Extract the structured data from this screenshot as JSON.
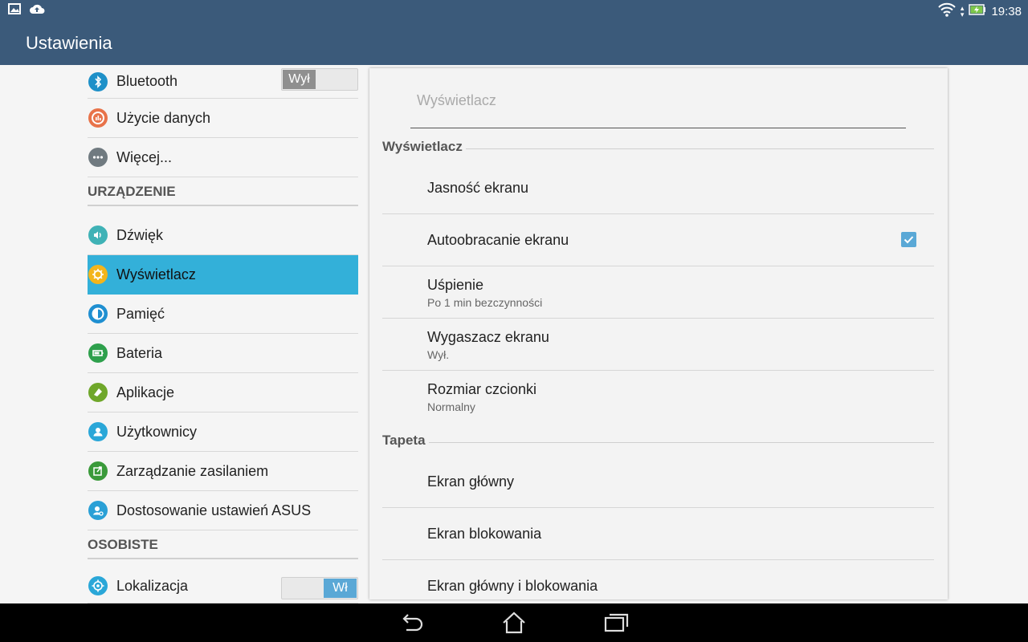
{
  "status_bar": {
    "time": "19:38",
    "icons": [
      "image-notification-icon",
      "cloud-upload-icon",
      "wifi-icon",
      "battery-charging-icon"
    ]
  },
  "action_bar": {
    "title": "Ustawienia"
  },
  "sidebar": {
    "items_top": [
      {
        "label": "Bluetooth",
        "icon": "bluetooth-icon",
        "toggle": "Wył",
        "color": "#1e90c8"
      },
      {
        "label": "Użycie danych",
        "icon": "data-usage-icon",
        "color": "#e8734a"
      },
      {
        "label": "Więcej...",
        "icon": "more-icon",
        "color": "#707a80"
      }
    ],
    "section_device": "URZĄDZENIE",
    "items_device": [
      {
        "label": "Dźwięk",
        "icon": "sound-icon",
        "color": "#3fb2b6"
      },
      {
        "label": "Wyświetlacz",
        "icon": "display-icon",
        "color": "#f3b51b",
        "selected": true
      },
      {
        "label": "Pamięć",
        "icon": "storage-icon",
        "color": "#1f8fd1"
      },
      {
        "label": "Bateria",
        "icon": "battery-icon",
        "color": "#2ea04c"
      },
      {
        "label": "Aplikacje",
        "icon": "apps-icon",
        "color": "#6fa72a"
      },
      {
        "label": "Użytkownicy",
        "icon": "users-icon",
        "color": "#2aa7d8"
      },
      {
        "label": "Zarządzanie zasilaniem",
        "icon": "power-management-icon",
        "color": "#3a9a3a"
      },
      {
        "label": "Dostosowanie ustawień ASUS",
        "icon": "asus-customize-icon",
        "color": "#2aa0d6"
      }
    ],
    "section_personal": "OSOBISTE",
    "items_personal": [
      {
        "label": "Lokalizacja",
        "icon": "location-icon",
        "toggle": "Wł",
        "color": "#2aa7d8"
      }
    ]
  },
  "panel": {
    "header": "Wyświetlacz",
    "section_display": "Wyświetlacz",
    "rows_display": [
      {
        "title": "Jasność ekranu"
      },
      {
        "title": "Autoobracanie ekranu",
        "checked": true
      },
      {
        "title": "Uśpienie",
        "subtitle": "Po 1 min bezczynności"
      },
      {
        "title": "Wygaszacz ekranu",
        "subtitle": "Wył."
      },
      {
        "title": "Rozmiar czcionki",
        "subtitle": "Normalny"
      }
    ],
    "section_wallpaper": "Tapeta",
    "rows_wallpaper": [
      {
        "title": "Ekran główny"
      },
      {
        "title": "Ekran blokowania"
      },
      {
        "title": "Ekran główny i blokowania"
      }
    ]
  },
  "nav_bar": {
    "buttons": [
      "back-icon",
      "home-icon",
      "recents-icon"
    ]
  }
}
